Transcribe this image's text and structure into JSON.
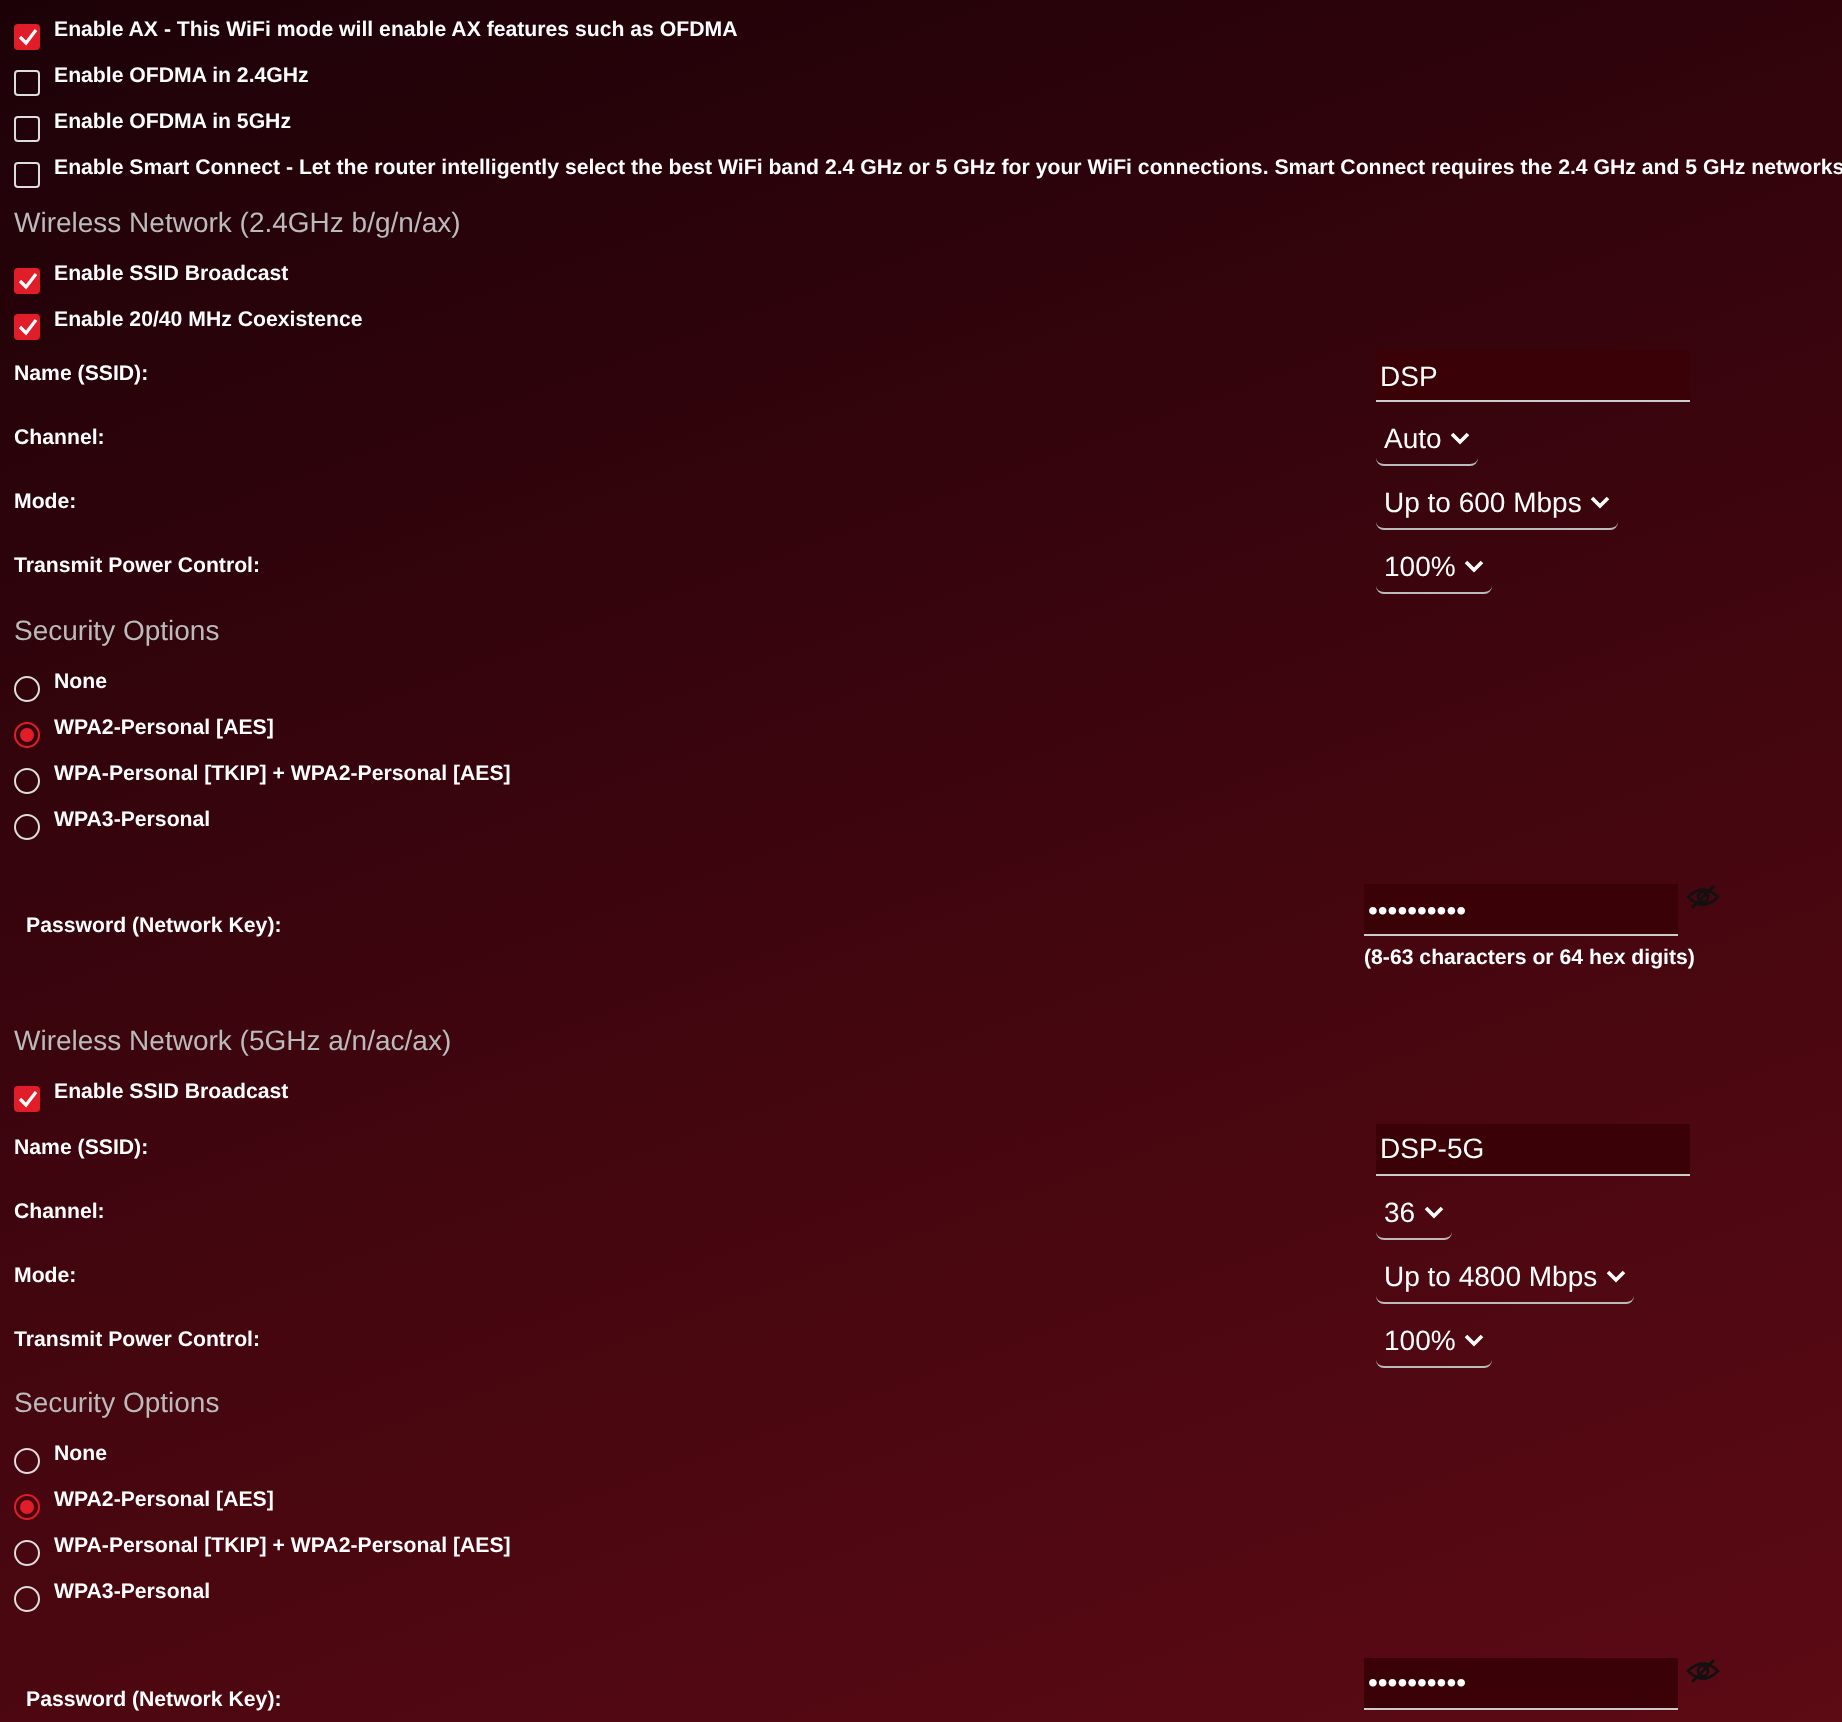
{
  "general_options": [
    {
      "label": "Enable AX - This WiFi mode will enable AX features such as OFDMA",
      "checked": true
    },
    {
      "label": "Enable OFDMA in 2.4GHz",
      "checked": false
    },
    {
      "label": "Enable OFDMA in 5GHz",
      "checked": false
    },
    {
      "label": "Enable Smart Connect - Let the router intelligently select the best WiFi band 2.4 GHz or 5 GHz for your WiFi connections. Smart Connect requires the 2.4 GHz and 5 GHz networks",
      "checked": false
    }
  ],
  "networks": [
    {
      "title": "Wireless Network (2.4GHz b/g/n/ax)",
      "options": [
        {
          "label": "Enable SSID Broadcast",
          "checked": true
        },
        {
          "label": "Enable 20/40 MHz Coexistence",
          "checked": true
        }
      ],
      "fields": [
        {
          "kind": "text",
          "label": "Name (SSID):",
          "value": "DSP"
        },
        {
          "kind": "select",
          "label": "Channel:",
          "value": "Auto"
        },
        {
          "kind": "select",
          "label": "Mode:",
          "value": "Up to 600 Mbps"
        },
        {
          "kind": "select",
          "label": "Transmit Power Control:",
          "value": "100%"
        }
      ],
      "security_title": "Security Options",
      "security_options": [
        {
          "label": "None",
          "selected": false
        },
        {
          "label": "WPA2-Personal [AES]",
          "selected": true
        },
        {
          "label": "WPA-Personal [TKIP] + WPA2-Personal [AES]",
          "selected": false
        },
        {
          "label": "WPA3-Personal",
          "selected": false
        }
      ],
      "password": {
        "label": "Password (Network Key):",
        "value": "••••••••••",
        "hint": "(8-63 characters or 64 hex digits)"
      }
    },
    {
      "title": "Wireless Network (5GHz a/n/ac/ax)",
      "options": [
        {
          "label": "Enable SSID Broadcast",
          "checked": true
        }
      ],
      "fields": [
        {
          "kind": "text",
          "label": "Name (SSID):",
          "value": "DSP-5G"
        },
        {
          "kind": "select",
          "label": "Channel:",
          "value": "36"
        },
        {
          "kind": "select",
          "label": "Mode:",
          "value": "Up to 4800 Mbps"
        },
        {
          "kind": "select",
          "label": "Transmit Power Control:",
          "value": "100%"
        }
      ],
      "security_title": "Security Options",
      "security_options": [
        {
          "label": "None",
          "selected": false
        },
        {
          "label": "WPA2-Personal [AES]",
          "selected": true
        },
        {
          "label": "WPA-Personal [TKIP] + WPA2-Personal [AES]",
          "selected": false
        },
        {
          "label": "WPA3-Personal",
          "selected": false
        }
      ],
      "password": {
        "label": "Password (Network Key):",
        "value": "••••••••••"
      }
    }
  ]
}
